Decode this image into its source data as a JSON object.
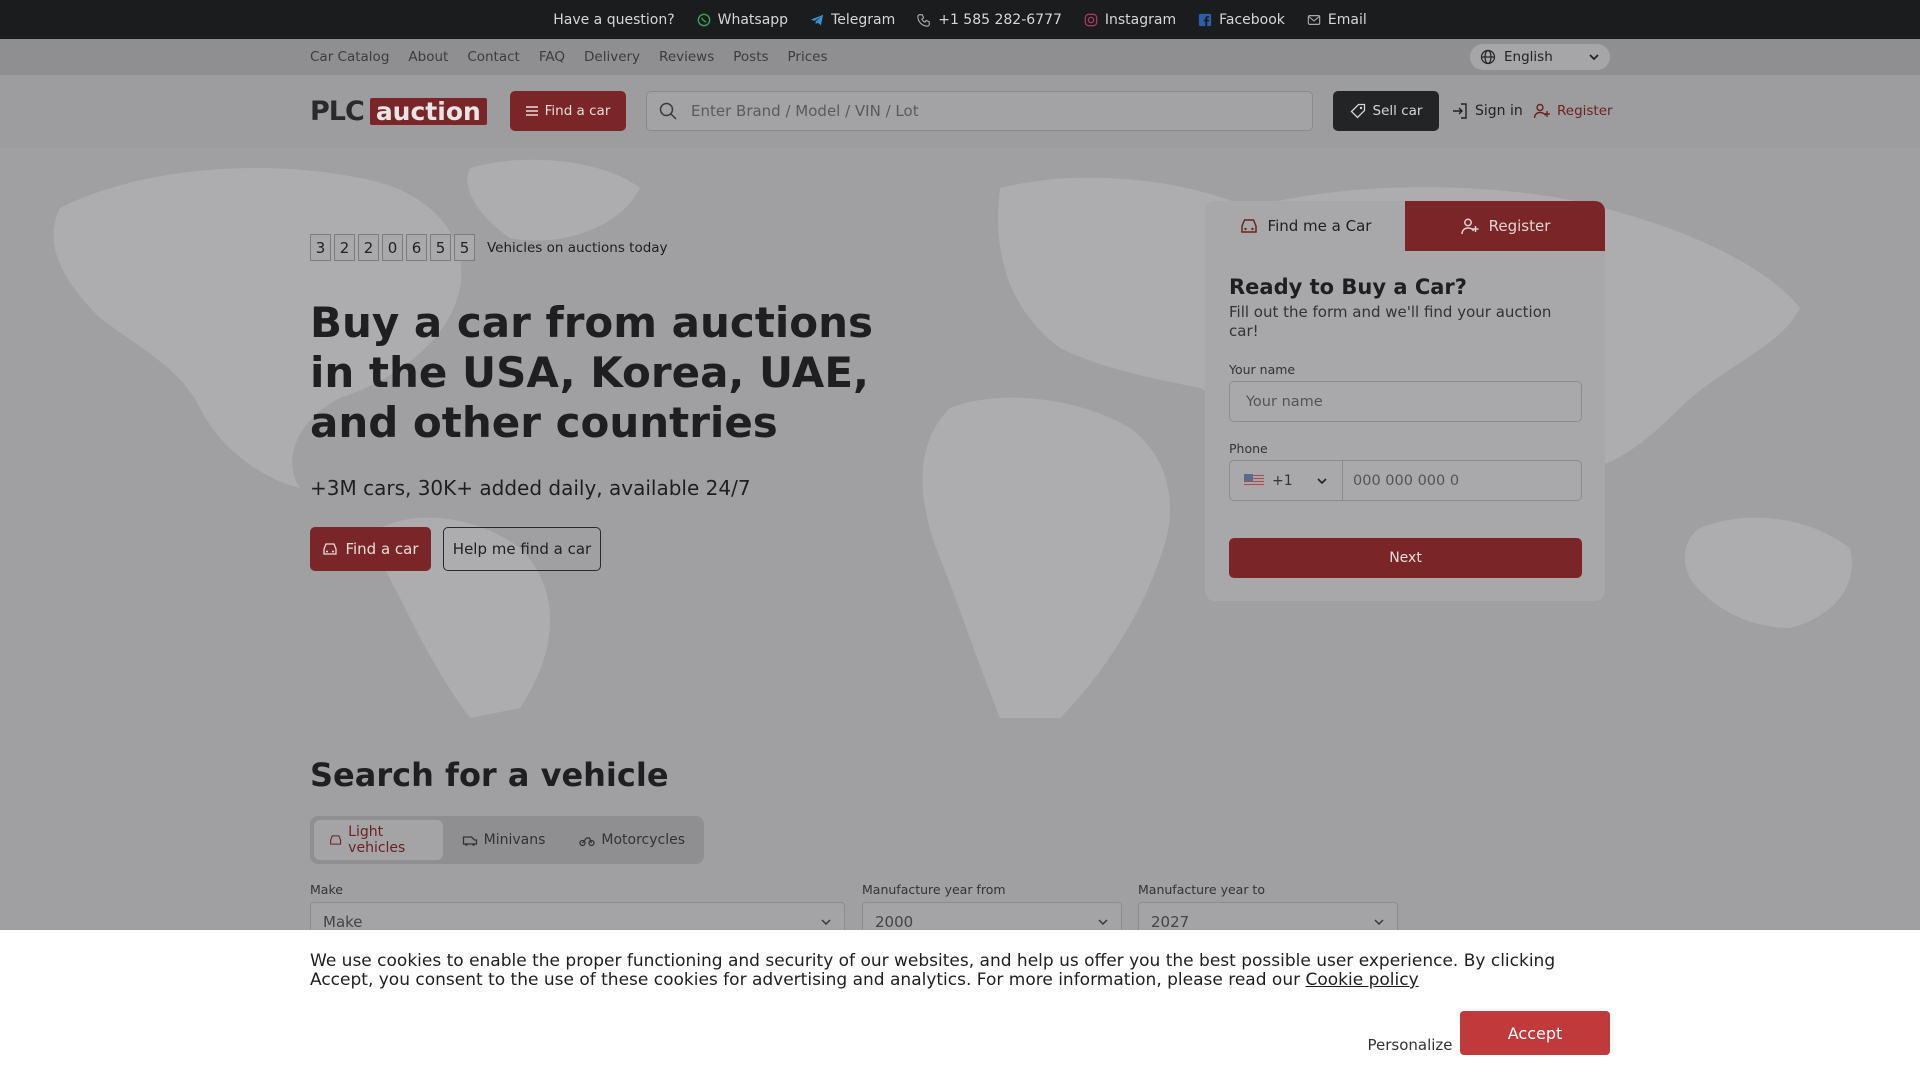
{
  "topbar": {
    "question": "Have a question?",
    "whatsapp": "Whatsapp",
    "telegram": "Telegram",
    "phone": "+1 585 282-6777",
    "instagram": "Instagram",
    "facebook": "Facebook",
    "email": "Email"
  },
  "nav": {
    "links": [
      "Car Catalog",
      "About",
      "Contact",
      "FAQ",
      "Delivery",
      "Reviews",
      "Posts",
      "Prices"
    ],
    "language": "English"
  },
  "header": {
    "logo_plc": "PLC",
    "logo_auction": "auction",
    "find_car": "Find a car",
    "search_placeholder": "Enter Brand / Model / VIN / Lot",
    "sell_car": "Sell car",
    "sign_in": "Sign in",
    "register": "Register"
  },
  "hero": {
    "counter_digits": [
      "3",
      "2",
      "2",
      "0",
      "6",
      "5",
      "5"
    ],
    "counter_label": "Vehicles on auctions today",
    "title": "Buy a car from auctions in the USA, Korea, UAE, and other countries",
    "subtitle": "+3M cars, 30K+ added daily, available 24/7",
    "find_car": "Find a car",
    "help_find": "Help me find a car"
  },
  "form": {
    "tab_find": "Find me a Car",
    "tab_register": "Register",
    "title": "Ready to Buy a Car?",
    "subtitle": "Fill out the form and we'll find your auction car!",
    "name_label": "Your name",
    "name_placeholder": "Your name",
    "phone_label": "Phone",
    "country_code": "+1",
    "phone_placeholder": "000 000 000 0",
    "next": "Next"
  },
  "vehicle_search": {
    "title": "Search for a vehicle",
    "tabs": [
      "Light vehicles",
      "Minivans",
      "Motorcycles"
    ],
    "make_label": "Make",
    "make_placeholder": "Make",
    "year_from_label": "Manufacture year from",
    "year_from": "2000",
    "year_to_label": "Manufacture year to",
    "year_to": "2027"
  },
  "cookie": {
    "text": "We use cookies to enable the proper functioning and security of our websites, and help us offer you the best possible user experience. By clicking Accept, you consent to the use of these cookies for advertising and analytics. For more information, please read our ",
    "link": "Cookie policy",
    "personalize": "Personalize",
    "accept": "Accept"
  },
  "colors": {
    "brand": "#c0393b",
    "brand_dimmed": "#7a2629",
    "overlay_gray": "#a0a0a2",
    "topbar": "#1b1c1e"
  }
}
